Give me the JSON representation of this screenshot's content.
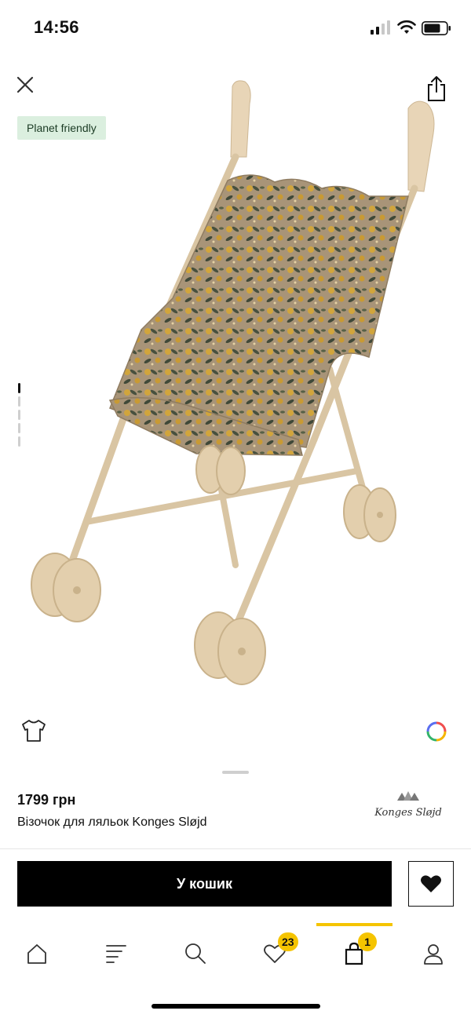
{
  "status_bar": {
    "time": "14:56"
  },
  "product": {
    "badge": "Planet friendly",
    "price": "1799 грн",
    "name": "Візочок для ляльок Konges Sløjd",
    "brand_logo_text": "Konges Sløjd"
  },
  "gallery": {
    "image_count": 5,
    "active_index": 0,
    "image_subject": "doll-stroller-image"
  },
  "actions": {
    "cart_label": "У кошик"
  },
  "tabbar": {
    "favorites_count": "23",
    "cart_count": "1",
    "active_tab": "cart",
    "items": [
      "home-icon",
      "catalog-icon",
      "search-icon",
      "favorites-icon",
      "cart-icon",
      "profile-icon"
    ]
  },
  "colors": {
    "accent": "#f5c400",
    "badge_bg": "#dbefdf",
    "primary_button": "#000000"
  }
}
